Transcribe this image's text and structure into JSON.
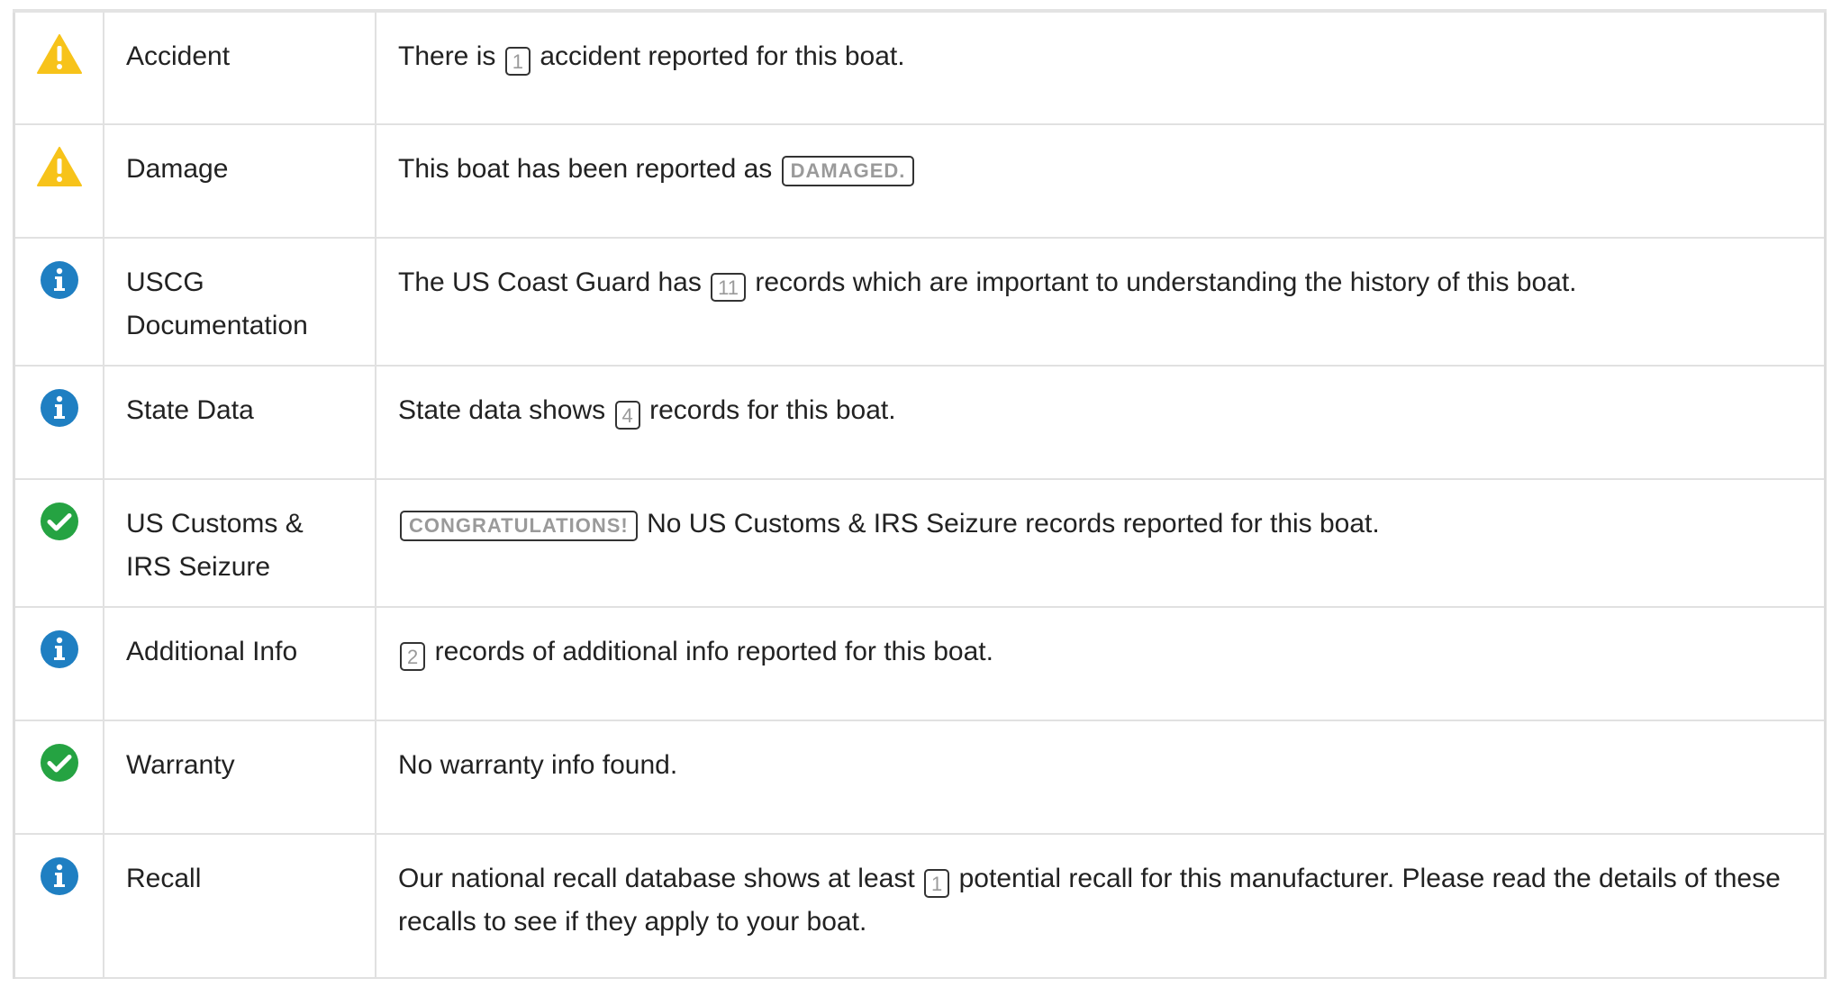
{
  "colors": {
    "warning": "#f7c31a",
    "info": "#1f7fc2",
    "success": "#25a342",
    "badge_text": "#9a9a9a",
    "border": "#e1e1e1"
  },
  "rows": [
    {
      "icon": "warning-icon",
      "label": "Accident",
      "desc_before": "There is",
      "badge": "1",
      "desc_after": "accident reported for this boat."
    },
    {
      "icon": "warning-icon",
      "label": "Damage",
      "desc_before": "This boat has been reported as",
      "badge": "DAMAGED."
    },
    {
      "icon": "info-icon",
      "label": "USCG Documentation",
      "desc_before": "The US Coast Guard has",
      "badge": "11",
      "desc_after": "records which are important to understanding the history of this boat."
    },
    {
      "icon": "info-icon",
      "label": "State Data",
      "desc_before": "State data shows",
      "badge": "4",
      "desc_after": "records for this boat."
    },
    {
      "icon": "check-icon",
      "label": "US Customs & IRS Seizure",
      "badge": "CONGRATULATIONS!",
      "desc_after": "No US Customs & IRS Seizure records reported for this boat."
    },
    {
      "icon": "info-icon",
      "label": "Additional Info",
      "badge": "2",
      "desc_after": "records of additional info reported for this boat."
    },
    {
      "icon": "check-icon",
      "label": "Warranty",
      "desc_before": "No warranty info found."
    },
    {
      "icon": "info-icon",
      "label": "Recall",
      "desc_before": "Our national recall database shows at least",
      "badge": "1",
      "desc_after": "potential recall for this manufacturer. Please read the details of these recalls to see if they apply to your boat."
    }
  ]
}
